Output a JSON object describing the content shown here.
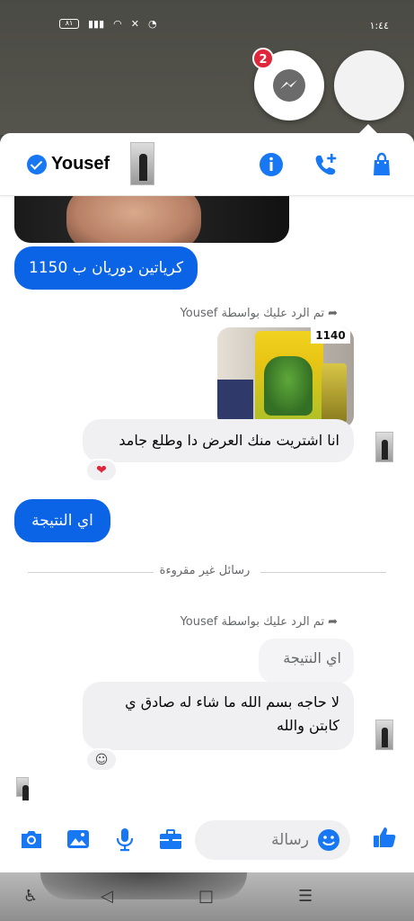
{
  "status_bar": {
    "time": "١:٤٤",
    "battery": "٨١"
  },
  "chat_heads": {
    "badge_count": "2"
  },
  "header": {
    "contact_name": "Yousef"
  },
  "messages": {
    "out_1": "كرياتين دوريان ب 1150",
    "reply_note_1": "تم الرد عليك بواسطة Yousef",
    "sticker_price": "1140",
    "in_1": "انا اشتريت منك العرض دا وطلع جامد",
    "reaction_1": "❤",
    "out_2": "اي النتيجة",
    "divider": "رسائل غير مقروءة",
    "reply_note_2": "تم الرد عليك بواسطة Yousef",
    "quoted_2": "اي النتيجة",
    "in_2": "لا حاجه بسم الله ما شاء له صادق ي كابتن والله"
  },
  "composer": {
    "placeholder": "رسالة"
  },
  "colors": {
    "messenger_blue": "#0b63e6",
    "icon_blue": "#1877f2",
    "badge_red": "#e0263a",
    "incoming_bubble": "#f0f0f3"
  }
}
